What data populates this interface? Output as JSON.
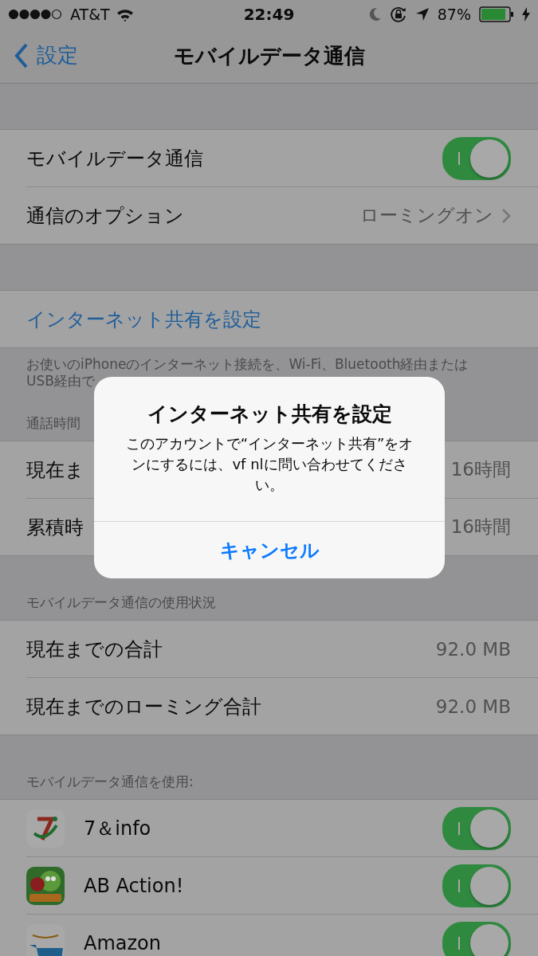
{
  "status_bar": {
    "carrier": "AT&T",
    "time": "22:49",
    "battery": "87%"
  },
  "nav": {
    "back": "設定",
    "title": "モバイルデータ通信"
  },
  "groups": [
    {
      "rows": [
        {
          "kind": "toggle",
          "label": "モバイルデータ通信",
          "on": true
        },
        {
          "kind": "detail",
          "label": "通信のオプション",
          "value": "ローミングオン"
        }
      ]
    },
    {
      "rows": [
        {
          "kind": "link",
          "label": "インターネット共有を設定"
        }
      ],
      "footer": [
        "お使いのiPhoneのインターネット接続を、Wi-Fi、Bluetooth経由または",
        "USB経由で"
      ]
    },
    {
      "header": "通話時間",
      "rows": [
        {
          "kind": "value",
          "label": "現在ま",
          "value": "16時間"
        },
        {
          "kind": "value",
          "label": "累積時",
          "value": "16時間"
        }
      ]
    },
    {
      "header": "モバイルデータ通信の使用状況",
      "rows": [
        {
          "kind": "value",
          "label": "現在までの合計",
          "value": "92.0 MB"
        },
        {
          "kind": "value",
          "label": "現在までのローミング合計",
          "value": "92.0 MB"
        }
      ]
    },
    {
      "header": "モバイルデータ通信を使用:",
      "rows": [
        {
          "kind": "app",
          "label": "7＆info",
          "on": true
        },
        {
          "kind": "app",
          "label": "AB Action!",
          "on": true
        },
        {
          "kind": "app",
          "label": "Amazon",
          "on": true
        }
      ]
    }
  ],
  "alert": {
    "title": "インターネット共有を設定",
    "message": "このアカウントで“インターネット共有”をオンにするには、vf nlに問い合わせてください。",
    "button": "キャンセル"
  }
}
